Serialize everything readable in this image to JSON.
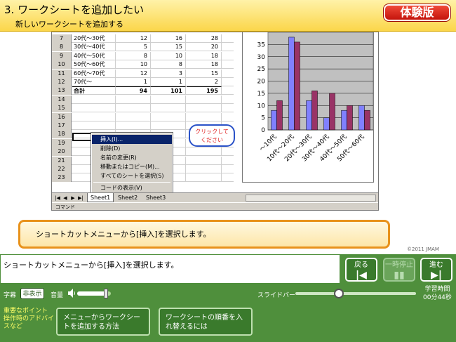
{
  "header": {
    "title": "3. ワークシートを追加したい",
    "subtitle": "新しいワークシートを追加する",
    "badge": "体験版"
  },
  "spreadsheet": {
    "rows": [
      {
        "num": "7",
        "label": "20代～30代",
        "v1": "12",
        "v2": "16",
        "v3": "28"
      },
      {
        "num": "8",
        "label": "30代～40代",
        "v1": "5",
        "v2": "15",
        "v3": "20"
      },
      {
        "num": "9",
        "label": "40代～50代",
        "v1": "8",
        "v2": "10",
        "v3": "18"
      },
      {
        "num": "10",
        "label": "50代～60代",
        "v1": "10",
        "v2": "8",
        "v3": "18"
      },
      {
        "num": "11",
        "label": "60代～70代",
        "v1": "12",
        "v2": "3",
        "v3": "15"
      },
      {
        "num": "12",
        "label": "70代～",
        "v1": "1",
        "v2": "1",
        "v3": "2"
      },
      {
        "num": "13",
        "label": "合計",
        "v1": "94",
        "v2": "101",
        "v3": "195"
      },
      {
        "num": "14",
        "label": "",
        "v1": "",
        "v2": "",
        "v3": ""
      },
      {
        "num": "15",
        "label": "",
        "v1": "",
        "v2": "",
        "v3": ""
      },
      {
        "num": "16",
        "label": "",
        "v1": "",
        "v2": "",
        "v3": ""
      },
      {
        "num": "17",
        "label": "",
        "v1": "",
        "v2": "",
        "v3": ""
      },
      {
        "num": "18",
        "label": "",
        "v1": "",
        "v2": "",
        "v3": ""
      },
      {
        "num": "19",
        "label": "",
        "v1": "",
        "v2": "",
        "v3": ""
      },
      {
        "num": "20",
        "label": "",
        "v1": "",
        "v2": "",
        "v3": ""
      },
      {
        "num": "21",
        "label": "",
        "v1": "",
        "v2": "",
        "v3": ""
      },
      {
        "num": "22",
        "label": "",
        "v1": "",
        "v2": "",
        "v3": ""
      },
      {
        "num": "23",
        "label": "",
        "v1": "",
        "v2": "",
        "v3": ""
      }
    ],
    "context_menu": [
      "挿入(I)...",
      "削除(D)",
      "名前の変更(R)",
      "移動またはコピー(M)...",
      "すべてのシートを選択(S)",
      "コードの表示(V)"
    ],
    "callout": [
      "クリックして",
      "ください"
    ],
    "tabs": [
      "Sheet1",
      "Sheet2",
      "Sheet3"
    ],
    "status": "コマンド"
  },
  "chart_data": {
    "type": "bar",
    "categories": [
      "～10代",
      "10代～20代",
      "20代～30代",
      "30代～40代",
      "40代～50代",
      "50代～60代"
    ],
    "series": [
      {
        "values": [
          8,
          38,
          12,
          5,
          8,
          10
        ],
        "color": "#8080ff"
      },
      {
        "values": [
          12,
          36,
          16,
          15,
          10,
          8
        ],
        "color": "#993366"
      }
    ],
    "ylim": [
      0,
      40
    ],
    "yticks": [
      "0",
      "5",
      "10",
      "15",
      "20",
      "25",
      "30",
      "35"
    ],
    "grid": true
  },
  "instruction": "ショートカットメニューから[挿入]を選択します。",
  "copyright": "©2011 JMAM",
  "caption": {
    "text": "ショートカットメニューから[挿入]を選択します。",
    "back_label": "戻る",
    "pause_label": "一時停止",
    "next_label": "進む"
  },
  "controls": {
    "caption_label": "字幕",
    "caption_toggle": "非表示",
    "volume_label": "音量",
    "volume_level": 0.85,
    "slide_label": "スライドバー",
    "slide_progress": 0.36,
    "time_title": "学習時間",
    "time_value": "00分44秒"
  },
  "links": {
    "points_label": "重要なポイント 操作時のアドバイスなど",
    "items": [
      "メニューからワークシートを追加する方法",
      "ワークシートの順番を入れ替えるには"
    ]
  }
}
